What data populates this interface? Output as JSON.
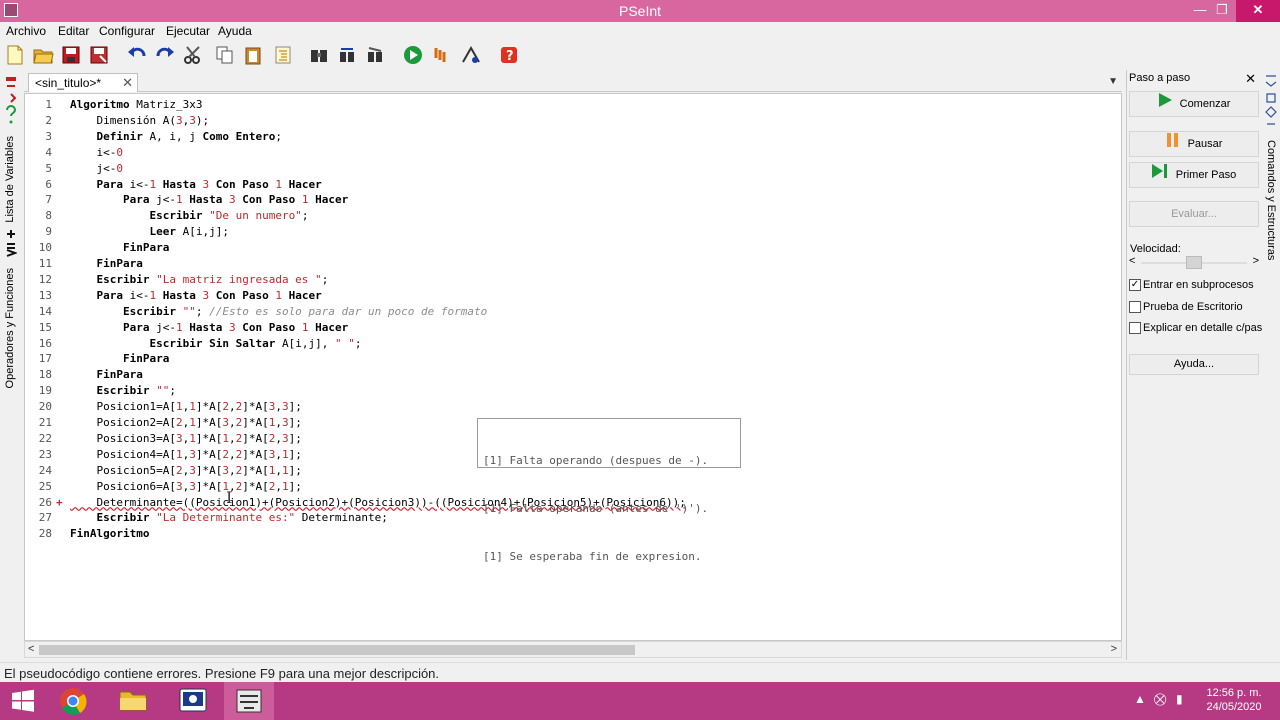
{
  "window": {
    "title": "PSeInt",
    "minimize": "—",
    "maximize": "❐",
    "close": "✕"
  },
  "menu": [
    "Archivo",
    "Editar",
    "Configurar",
    "Ejecutar",
    "Ayuda"
  ],
  "left_panel": {
    "variables_tab": "Lista de Variables",
    "operators_tab": "Operadores y Funciones"
  },
  "editor": {
    "tab_label": "<sin_titulo>*",
    "tab_close": "✕",
    "lines": [
      {
        "n": "1",
        "code": "Algoritmo Matriz_3x3"
      },
      {
        "n": "2",
        "code": "    Dimensión A(3,3);"
      },
      {
        "n": "3",
        "code": "    Definir A, i, j Como Entero;"
      },
      {
        "n": "4",
        "code": "    i<-0"
      },
      {
        "n": "5",
        "code": "    j<-0"
      },
      {
        "n": "6",
        "code": "    Para i<-1 Hasta 3 Con Paso 1 Hacer"
      },
      {
        "n": "7",
        "code": "        Para j<-1 Hasta 3 Con Paso 1 Hacer"
      },
      {
        "n": "8",
        "code": "            Escribir \"De un numero\";"
      },
      {
        "n": "9",
        "code": "            Leer A[i,j];"
      },
      {
        "n": "10",
        "code": "        FinPara"
      },
      {
        "n": "11",
        "code": "    FinPara"
      },
      {
        "n": "12",
        "code": "    Escribir \"La matriz ingresada es \";"
      },
      {
        "n": "13",
        "code": "    Para i<-1 Hasta 3 Con Paso 1 Hacer"
      },
      {
        "n": "14",
        "code": "        Escribir \"\"; //Esto es solo para dar un poco de formato"
      },
      {
        "n": "15",
        "code": "        Para j<-1 Hasta 3 Con Paso 1 Hacer"
      },
      {
        "n": "16",
        "code": "            Escribir Sin Saltar A[i,j], \" \";"
      },
      {
        "n": "17",
        "code": "        FinPara"
      },
      {
        "n": "18",
        "code": "    FinPara"
      },
      {
        "n": "19",
        "code": "    Escribir \"\";"
      },
      {
        "n": "20",
        "code": "    Posicion1=A[1,1]*A[2,2]*A[3,3];"
      },
      {
        "n": "21",
        "code": "    Posicion2=A[2,1]*A[3,2]*A[1,3];"
      },
      {
        "n": "22",
        "code": "    Posicion3=A[3,1]*A[1,2]*A[2,3];"
      },
      {
        "n": "23",
        "code": "    Posicion4=A[1,3]*A[2,2]*A[3,1];"
      },
      {
        "n": "24",
        "code": "    Posicion5=A[2,3]*A[3,2]*A[1,1];"
      },
      {
        "n": "25",
        "code": "    Posicion6=A[3,3]*A[1,2]*A[2,1];"
      },
      {
        "n": "26",
        "code": "    Determinante=((Posicion1)+(Posicion2)+(Posicion3))-((Posicion4)+(Posicion5)+(Posicion6));",
        "marker": "+"
      },
      {
        "n": "27",
        "code": "    Escribir \"La Determinante es:\" Determinante;"
      },
      {
        "n": "28",
        "code": "FinAlgoritmo"
      }
    ],
    "errors": [
      "[1] Falta operando (despues de -).",
      "[1] Falta operando (antes de ')').",
      "[1] Se esperaba fin de expresion."
    ]
  },
  "step_panel": {
    "title": "Paso a paso",
    "close": "✕",
    "start": "Comenzar",
    "pause": "Pausar",
    "first_step": "Primer Paso",
    "evaluate": "Evaluar...",
    "speed_label": "Velocidad:",
    "speed": 0.5,
    "checkboxes": [
      {
        "label": "Entrar en subprocesos",
        "checked": true
      },
      {
        "label": "Prueba de Escritorio",
        "checked": false
      },
      {
        "label": "Explicar en detalle c/paso",
        "checked": false
      }
    ],
    "help": "Ayuda..."
  },
  "right_strip": {
    "label": "Comandos y Estructuras"
  },
  "status": {
    "message": "El pseudocódigo contiene errores. Presione F9 para una mejor descripción."
  },
  "taskbar": {
    "time": "12:56 p. m.",
    "date": "24/05/2020"
  },
  "colors": {
    "titlebar": "#d8669f",
    "taskbar": "#b53a83",
    "keyword": "#000000",
    "string": "#c0282f",
    "comment": "#8c8c8c",
    "run_green": "#1a9a3a"
  }
}
